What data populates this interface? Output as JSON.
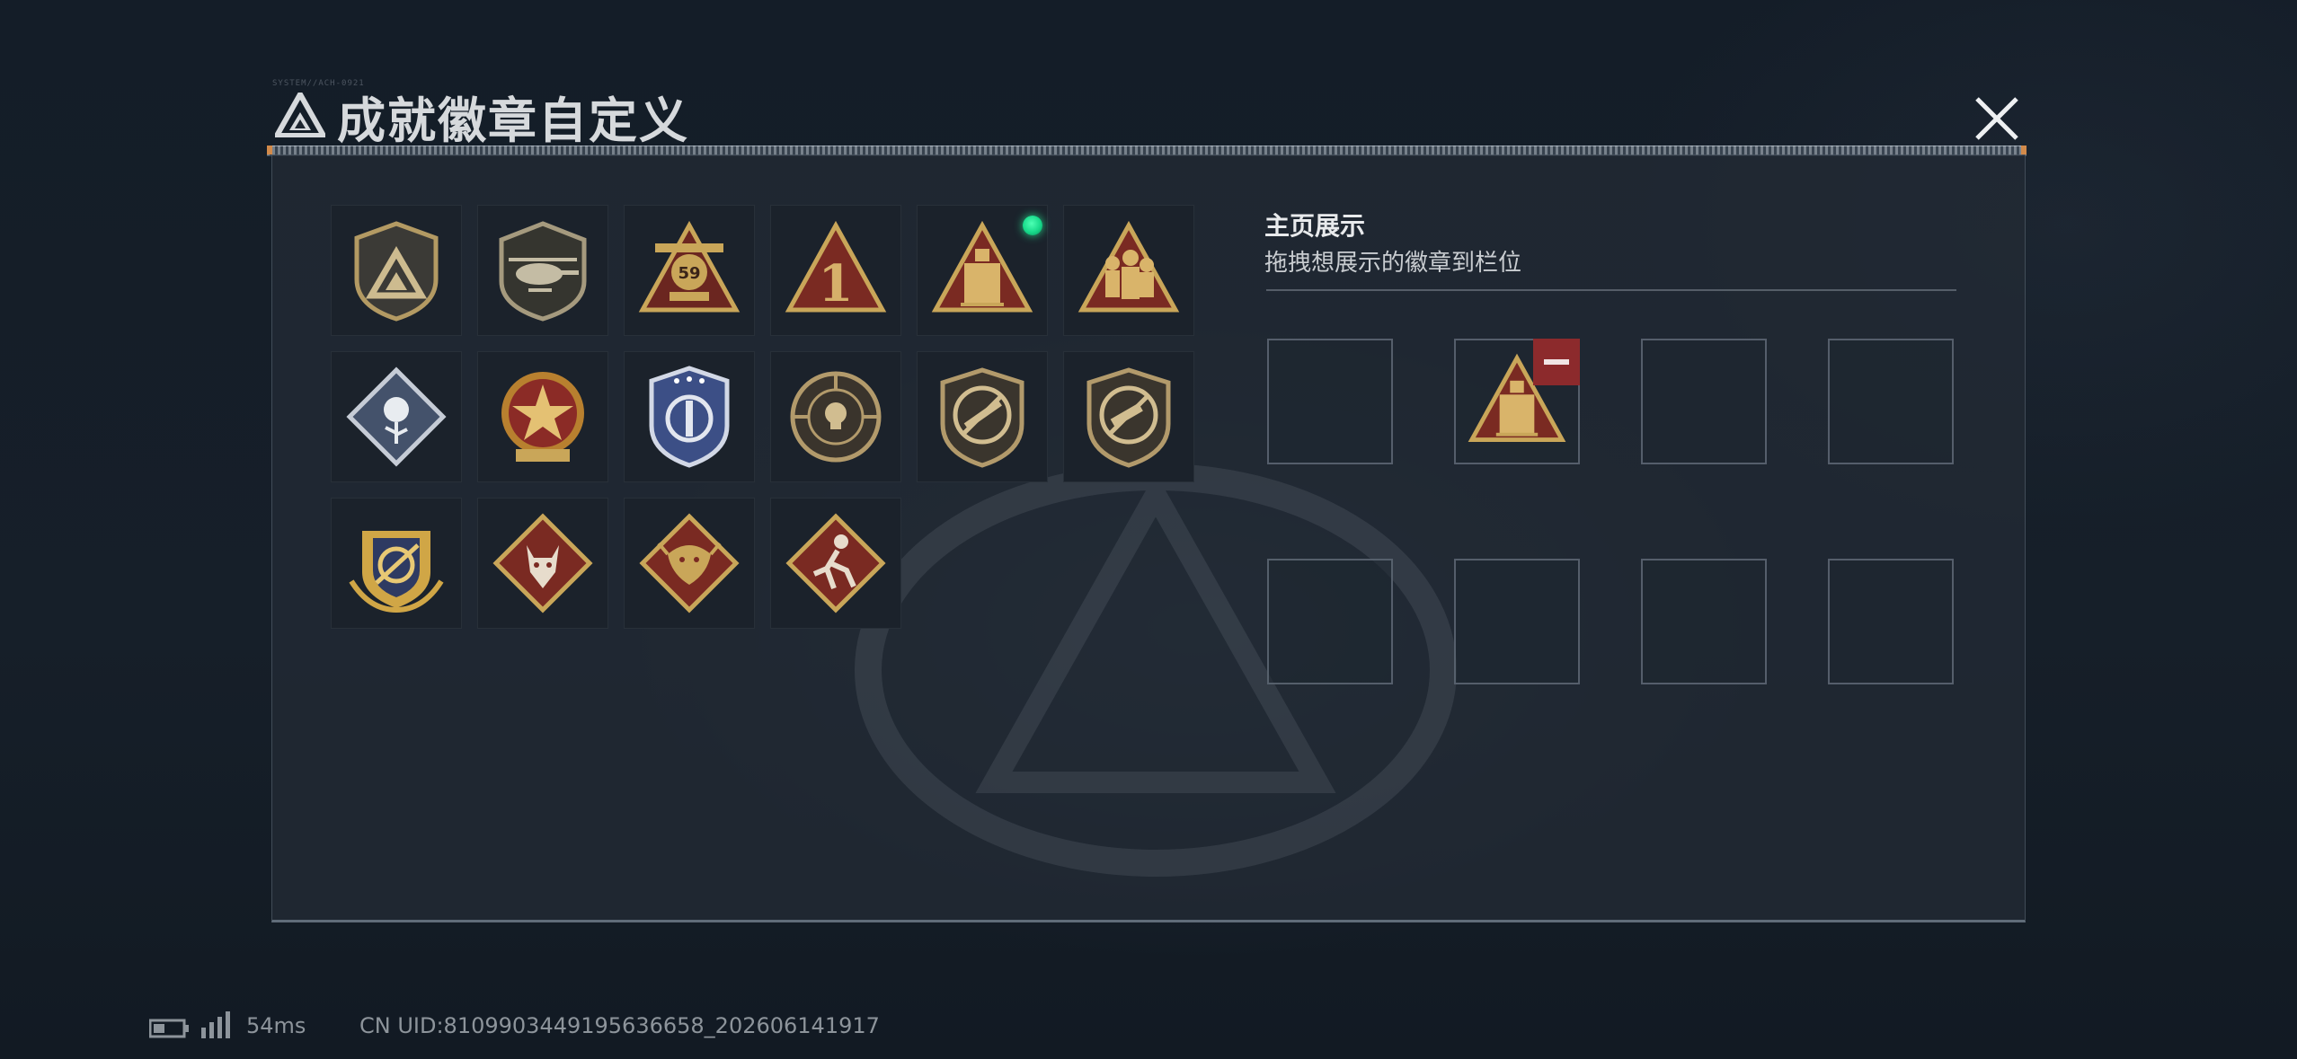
{
  "header": {
    "deco_text": "SYSTEM//ACH-0921",
    "title": "成就徽章自定义",
    "logo_icon": "triangle-a-logo-icon",
    "close_icon": "close-x-icon"
  },
  "badges": [
    {
      "name": "triangle-shield-badge",
      "row": 1,
      "col": 1
    },
    {
      "name": "helicopter-shield-badge",
      "row": 1,
      "col": 2
    },
    {
      "name": "number-59-badge",
      "row": 1,
      "col": 3
    },
    {
      "name": "number-1-triangle-badge",
      "row": 1,
      "col": 4
    },
    {
      "name": "tower-triangle-badge",
      "row": 1,
      "col": 5,
      "equipped": true
    },
    {
      "name": "soldiers-triangle-badge",
      "row": 1,
      "col": 6
    },
    {
      "name": "rose-diamond-badge",
      "row": 2,
      "col": 1
    },
    {
      "name": "star-medal-badge",
      "row": 2,
      "col": 2
    },
    {
      "name": "blue-shield-badge",
      "row": 2,
      "col": 3
    },
    {
      "name": "skull-crosshair-badge",
      "row": 2,
      "col": 4
    },
    {
      "name": "no-rifle-shield-badge",
      "row": 2,
      "col": 5
    },
    {
      "name": "no-smg-shield-badge",
      "row": 2,
      "col": 6
    },
    {
      "name": "gold-crest-badge",
      "row": 3,
      "col": 1
    },
    {
      "name": "wolf-diamond-badge",
      "row": 3,
      "col": 2
    },
    {
      "name": "dragon-diamond-badge",
      "row": 3,
      "col": 3
    },
    {
      "name": "runner-diamond-badge",
      "row": 3,
      "col": 4
    }
  ],
  "showcase": {
    "title": "主页展示",
    "subtitle": "拖拽想展示的徽章到栏位",
    "slots": [
      {
        "index": 1,
        "badge": null
      },
      {
        "index": 2,
        "badge": "tower-triangle-badge",
        "remove_icon": "minus-icon"
      },
      {
        "index": 3,
        "badge": null
      },
      {
        "index": 4,
        "badge": null
      },
      {
        "index": 5,
        "badge": null
      },
      {
        "index": 6,
        "badge": null
      },
      {
        "index": 7,
        "badge": null
      },
      {
        "index": 8,
        "badge": null
      }
    ]
  },
  "footer": {
    "battery_icon": "battery-icon",
    "signal_icon": "signal-bars-icon",
    "ping": "54ms",
    "uid": "CN UID:8109903449195636658_202606141917"
  },
  "colors": {
    "accent_green": "#17d98a",
    "remove_red": "#8c2a2c",
    "gold": "#c9a659",
    "dark_red": "#7a2a22"
  }
}
